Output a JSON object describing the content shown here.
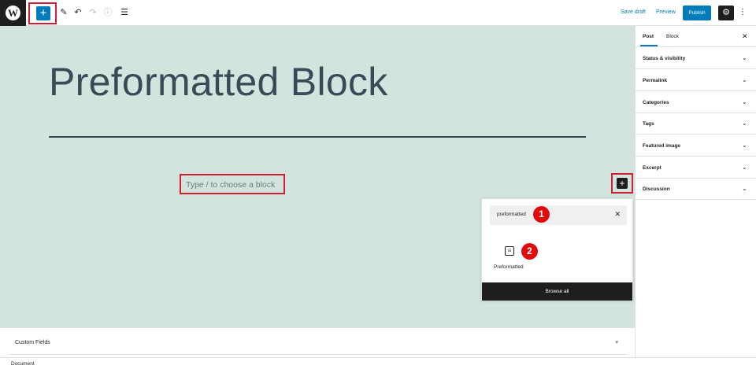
{
  "toolbar": {
    "logo_glyph": "W",
    "add_glyph": "+",
    "edit_glyph": "✎",
    "undo_glyph": "↶",
    "redo_glyph": "↷",
    "info_glyph": "ⓘ",
    "outline_glyph": "☰",
    "save_draft": "Save draft",
    "preview": "Preview",
    "publish": "Publish",
    "settings_glyph": "⚙",
    "more_glyph": "⋮",
    "icons": [
      "wordpress-logo",
      "plus-icon",
      "pencil-icon",
      "undo-icon",
      "redo-icon",
      "info-icon",
      "list-view-icon",
      "gear-icon",
      "more-vertical-icon"
    ]
  },
  "editor": {
    "title": "Preformatted Block",
    "block_placeholder": "Type / to choose a block",
    "inserter_glyph": "+",
    "canvas_color": "#d2e4dd",
    "highlight_color": "#d01f2e"
  },
  "inserter": {
    "search_value": "preformatted",
    "clear_glyph": "✕",
    "badge_1": "1",
    "badge_2": "2",
    "block_icon_glyph": "⊟",
    "block_label": "Preformatted",
    "browse_all": "Browse all"
  },
  "metabox": {
    "title": "Custom Fields",
    "toggle_glyph": "▾"
  },
  "footer": {
    "breadcrumb": "Document"
  },
  "sidebar": {
    "tabs": [
      {
        "label": "Post"
      },
      {
        "label": "Block"
      }
    ],
    "close_glyph": "✕",
    "chevron_glyph": "⌄",
    "panels": [
      {
        "label": "Status & visibility"
      },
      {
        "label": "Permalink"
      },
      {
        "label": "Categories"
      },
      {
        "label": "Tags"
      },
      {
        "label": "Featured image"
      },
      {
        "label": "Excerpt"
      },
      {
        "label": "Discussion"
      }
    ]
  },
  "colors": {
    "accent": "#007cba",
    "dark": "#1e1e1e",
    "badge": "#e10b0b"
  }
}
